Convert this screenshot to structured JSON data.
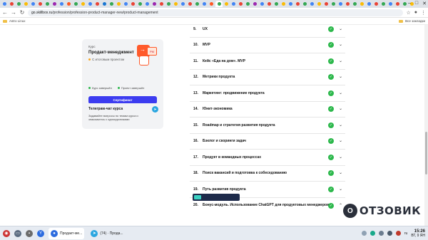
{
  "browser": {
    "tab_colors": [
      "#4285f4",
      "#ea4335",
      "#34a853",
      "#fbbc05",
      "#4285f4",
      "#ea4335",
      "#34a853",
      "#9c27b0",
      "#4285f4",
      "#ff5722",
      "#34a853",
      "#fbbc05",
      "#4285f4",
      "#ea4335",
      "#1976d2",
      "#34a853",
      "#fbbc05",
      "#4285f4",
      "#ea4335",
      "#34a853",
      "#4285f4",
      "#9c27b0",
      "#ea4335",
      "#34a853",
      "#fbbc05",
      "#4285f4",
      "#ea4335",
      "#34a853",
      "#4285f4",
      "#ff5722",
      "#34a853",
      "#fbbc05",
      "#4285f4",
      "#ea4335",
      "#34a853",
      "#9c27b0",
      "#4285f4",
      "#ea4335",
      "#34a853",
      "#fbbc05",
      "#4285f4",
      "#ea4335",
      "#34a853",
      "#4285f4",
      "#fbbc05",
      "#ea4335",
      "#34a853",
      "#4285f4",
      "#ea4335",
      "#34a853",
      "#fbbc05",
      "#4285f4",
      "#ea4335",
      "#34a853",
      "#4285f4",
      "#ea4335",
      "#34a853",
      "#fbbc05"
    ],
    "url_host": "go.skillbox.ru",
    "url_path": "/profession/profession-product-manager-new/product-management",
    "bookmark_left": "Astro Linux",
    "bookmark_right": "Все закладки"
  },
  "course_card": {
    "label": "Курс",
    "title": "Продакт-менеджмент",
    "subtitle": "С итоговым проектом",
    "art_text": "PM",
    "status_1": "Курс завершён",
    "status_2": "Проект завершён",
    "certificate_label": "Сертификат"
  },
  "telegram": {
    "title": "Телеграм-чат курса",
    "text": "Задавайте вопросы по темам курса и знакомьтесь с однокурсниками"
  },
  "modules": [
    {
      "num": "9.",
      "title": "UX"
    },
    {
      "num": "10.",
      "title": "MVP"
    },
    {
      "num": "11.",
      "title": "Кейс «Еда на дом». MVP"
    },
    {
      "num": "12.",
      "title": "Метрики продукта"
    },
    {
      "num": "13.",
      "title": "Маркетинг: продвижение продукта"
    },
    {
      "num": "14.",
      "title": "Юнит-экономика"
    },
    {
      "num": "15.",
      "title": "Roadmap и стратегия развития продукта"
    },
    {
      "num": "16.",
      "title": "Бэклог и скоринги задач"
    },
    {
      "num": "17.",
      "title": "Продукт в командных процессах"
    },
    {
      "num": "18.",
      "title": "Поиск вакансий и подготовка к собеседованию"
    },
    {
      "num": "19.",
      "title": "Путь развития продукта"
    },
    {
      "num": "20.",
      "title": "Бонус-модуль. Использование ChatGPT для продуктовых менеджеров"
    }
  ],
  "watermark": {
    "logo_letter": "О",
    "text": "ОТЗОВИК"
  },
  "taskbar": {
    "app_active": "Продакт-ме...",
    "app_telegram": "(74) · Прода...",
    "lang": "ru",
    "time": "15:26",
    "date": "ВТ, 9 ЯН"
  }
}
